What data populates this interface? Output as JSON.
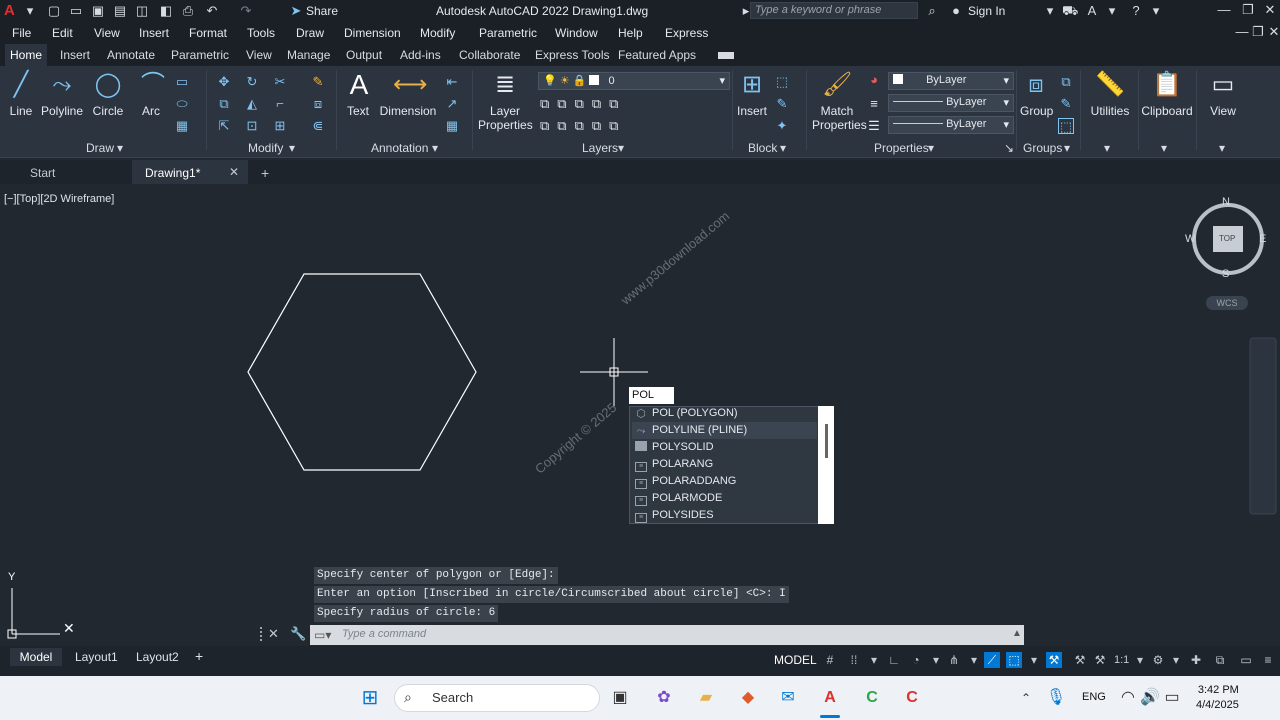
{
  "titlebar": {
    "title": "Autodesk AutoCAD 2022   Drawing1.dwg",
    "share_label": "Share",
    "search_placeholder": "Type a keyword or phrase",
    "signin_label": "Sign In"
  },
  "menubar": {
    "items": [
      "File",
      "Edit",
      "View",
      "Insert",
      "Format",
      "Tools",
      "Draw",
      "Dimension",
      "Modify",
      "Parametric",
      "Window",
      "Help",
      "Express"
    ]
  },
  "ribbon_tabs": {
    "items": [
      "Home",
      "Insert",
      "Annotate",
      "Parametric",
      "View",
      "Manage",
      "Output",
      "Add-ins",
      "Collaborate",
      "Express Tools",
      "Featured Apps"
    ]
  },
  "ribbon": {
    "draw": {
      "line": "Line",
      "polyline": "Polyline",
      "circle": "Circle",
      "arc": "Arc",
      "panel": "Draw"
    },
    "modify": {
      "panel": "Modify"
    },
    "annotation": {
      "text": "Text",
      "dimension": "Dimension",
      "panel": "Annotation"
    },
    "layers": {
      "layer_properties_1": "Layer",
      "layer_properties_2": "Properties",
      "layer_value": "0",
      "panel": "Layers"
    },
    "block": {
      "insert": "Insert",
      "panel": "Block"
    },
    "properties": {
      "match_1": "Match",
      "match_2": "Properties",
      "bylayer_color": "ByLayer",
      "bylayer_linetype": "ByLayer",
      "bylayer_lineweight": "ByLayer",
      "panel": "Properties"
    },
    "groups": {
      "group": "Group",
      "panel": "Groups"
    },
    "utilities": "Utilities",
    "clipboard": "Clipboard",
    "view": "View"
  },
  "doc_tabs": {
    "start": "Start",
    "drawing": "Drawing1*"
  },
  "viewport": {
    "label": "[−][Top][2D Wireframe]",
    "compass": {
      "n": "N",
      "s": "S",
      "e": "E",
      "w": "W",
      "top": "TOP",
      "wcs": "WCS"
    },
    "watermark_1": "www.p30download.com",
    "watermark_2": "Copyright © 2025"
  },
  "autocomplete": {
    "typed": "POL",
    "items": [
      "POL (POLYGON)",
      "POLYLINE (PLINE)",
      "POLYSOLID",
      "POLARANG",
      "POLARADDANG",
      "POLARMODE",
      "POLYSIDES"
    ]
  },
  "command_history": [
    "Specify center of polygon or [Edge]:",
    "Enter an option [Inscribed in circle/Circumscribed about circle] <C>: I",
    "Specify radius of circle: 6"
  ],
  "command_line": {
    "placeholder": "Type a command"
  },
  "layout_tabs": {
    "model": "Model",
    "layout1": "Layout1",
    "layout2": "Layout2"
  },
  "status": {
    "model": "MODEL",
    "scale": "1:1"
  },
  "taskbar": {
    "search": "Search",
    "lang": "ENG",
    "time": "3:42 PM",
    "date": "4/4/2025"
  },
  "colors": {
    "accent": "#0078d4",
    "bg_canvas": "#212830",
    "ribbon": "#2c3440",
    "autocad_red": "#e0302d"
  }
}
